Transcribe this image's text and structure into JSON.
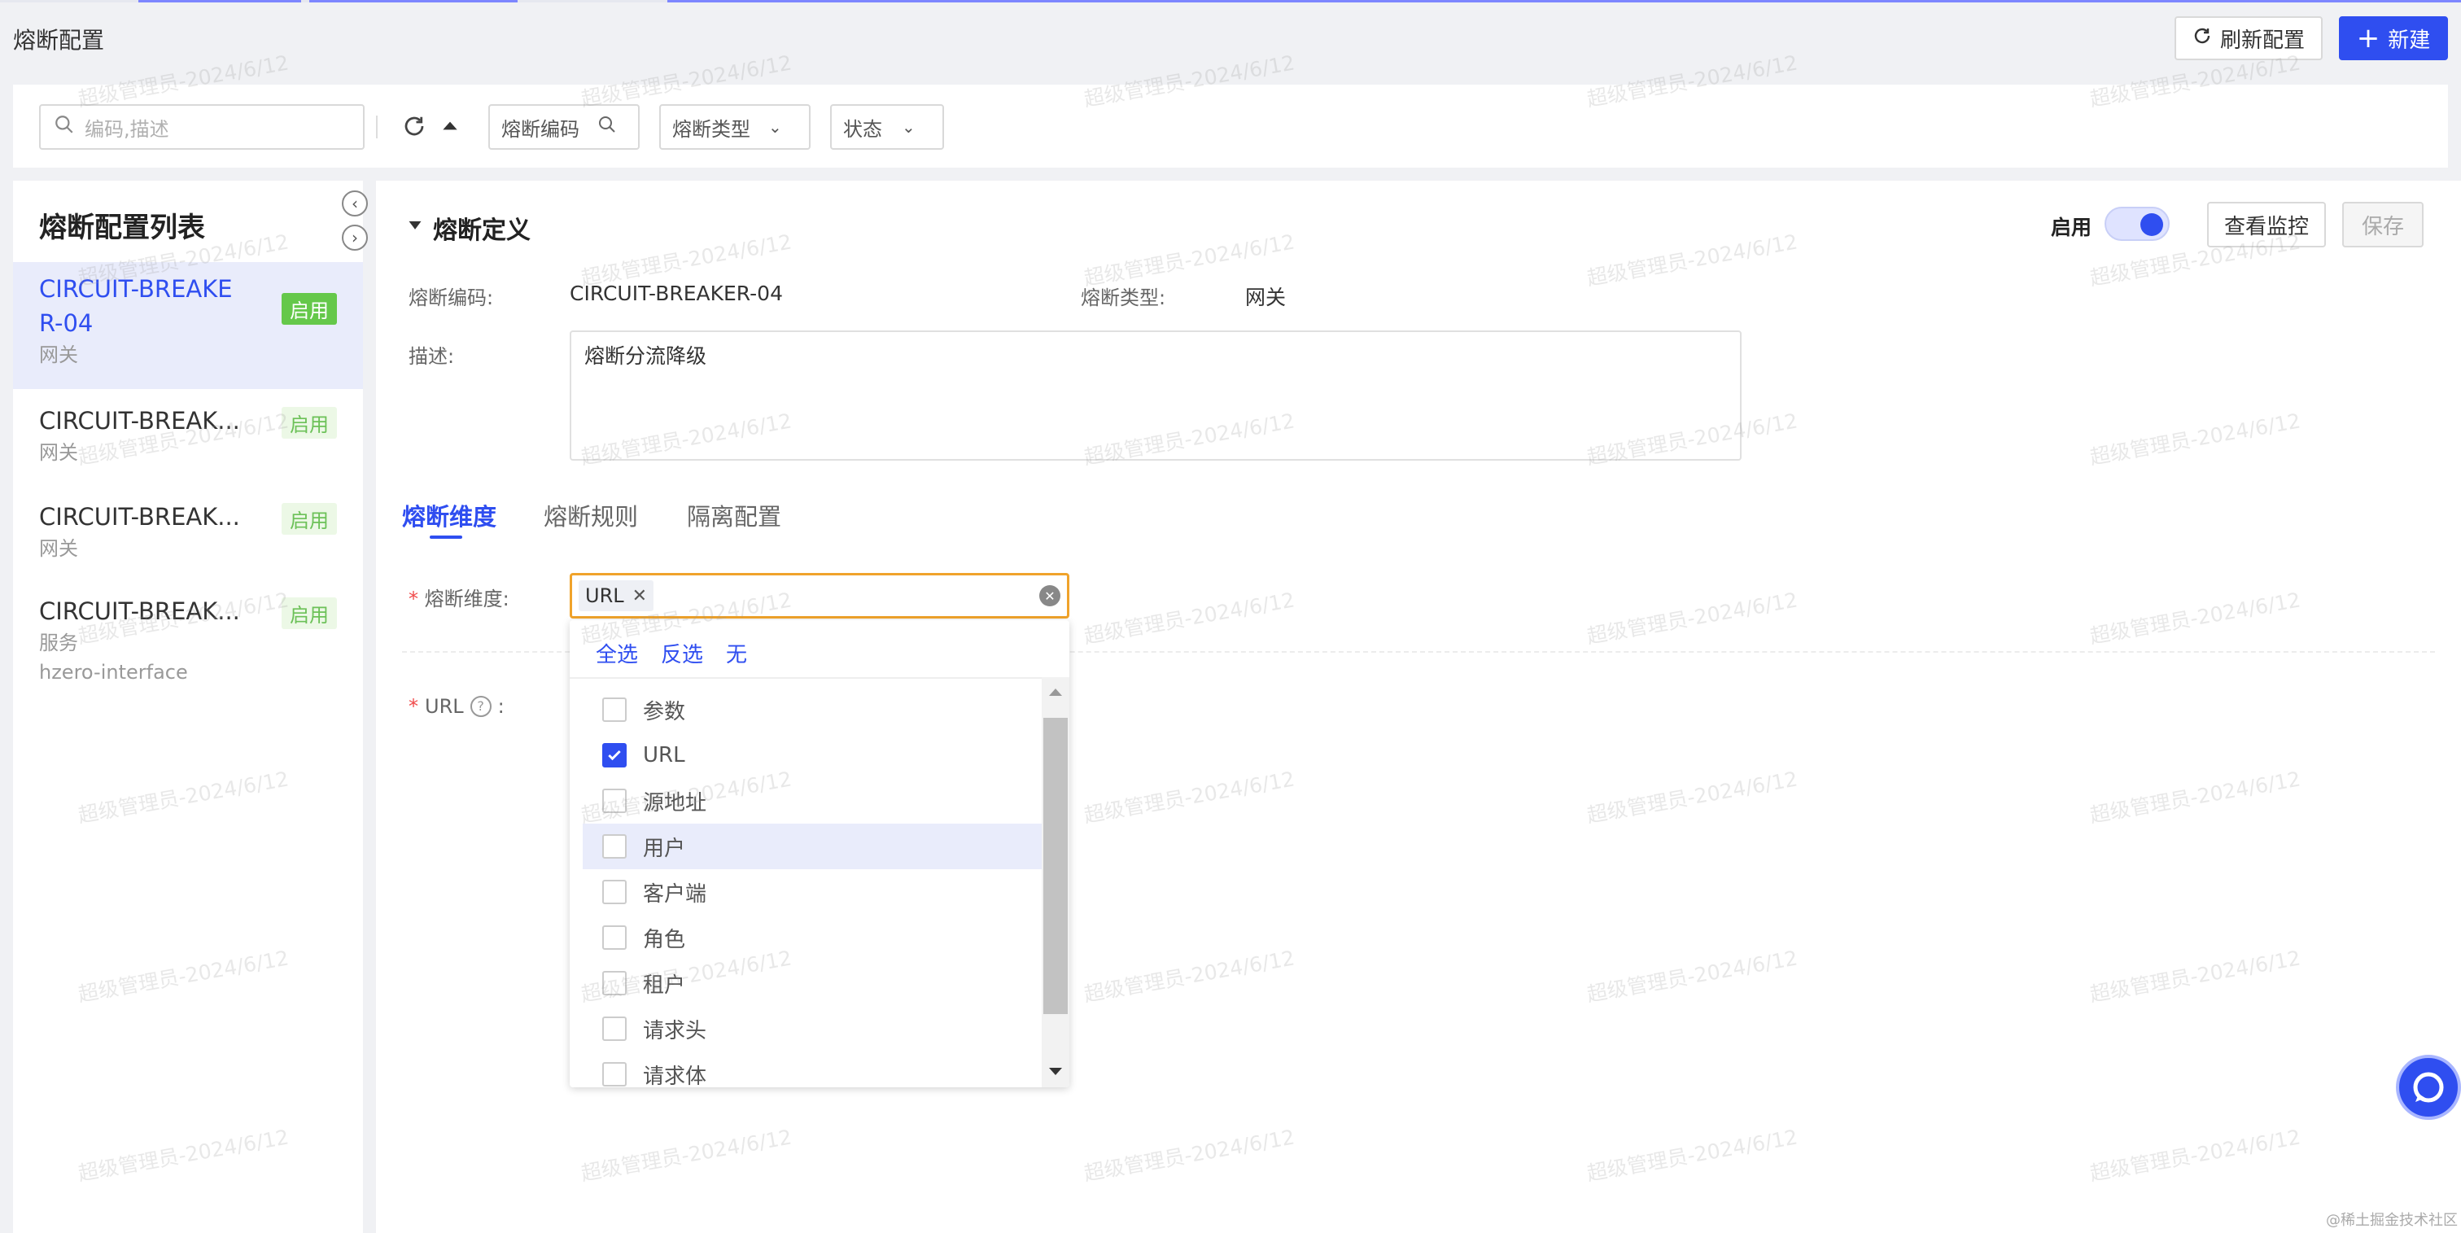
{
  "header": {
    "title": "熔断配置",
    "refresh_label": "刷新配置",
    "new_label": "新建"
  },
  "search": {
    "placeholder": "编码,描述",
    "code_filter": "熔断编码",
    "type_filter": "熔断类型",
    "status_filter": "状态"
  },
  "list": {
    "title": "熔断配置列表",
    "items": [
      {
        "title_line1": "CIRCUIT-BREAKE",
        "title_line2": "R-04",
        "sub": "网关",
        "badge": "启用"
      },
      {
        "title": "CIRCUIT-BREAK...",
        "sub": "网关",
        "badge": "启用"
      },
      {
        "title": "CIRCUIT-BREAK...",
        "sub": "网关",
        "badge": "启用"
      },
      {
        "title": "CIRCUIT-BREAK...",
        "sub": "服务",
        "sub2": "hzero-interface",
        "badge": "启用"
      }
    ]
  },
  "detail": {
    "section_title": "熔断定义",
    "enable_label": "启用",
    "enabled": true,
    "monitor_label": "查看监控",
    "save_label": "保存",
    "code_label": "熔断编码:",
    "code_value": "CIRCUIT-BREAKER-04",
    "type_label": "熔断类型:",
    "type_value": "网关",
    "desc_label": "描述:",
    "desc_value": "熔断分流降级"
  },
  "tabs": [
    "熔断维度",
    "熔断规则",
    "隔离配置"
  ],
  "dimension": {
    "label": "熔断维度:",
    "selected_tag": "URL",
    "url_label": "URL",
    "colon": ":"
  },
  "dropdown": {
    "select_all": "全选",
    "invert": "反选",
    "none": "无",
    "options": [
      {
        "label": "参数",
        "checked": false
      },
      {
        "label": "URL",
        "checked": true
      },
      {
        "label": "源地址",
        "checked": false
      },
      {
        "label": "用户",
        "checked": false,
        "hover": true
      },
      {
        "label": "客户端",
        "checked": false
      },
      {
        "label": "角色",
        "checked": false
      },
      {
        "label": "租户",
        "checked": false
      },
      {
        "label": "请求头",
        "checked": false
      },
      {
        "label": "请求体",
        "checked": false
      }
    ]
  },
  "watermark": "超级管理员-2024/6/12",
  "footer": "@稀土掘金技术社区",
  "colors": {
    "accent": "#2f4ef0",
    "success": "#65c84a",
    "danger": "#f04b4b"
  }
}
